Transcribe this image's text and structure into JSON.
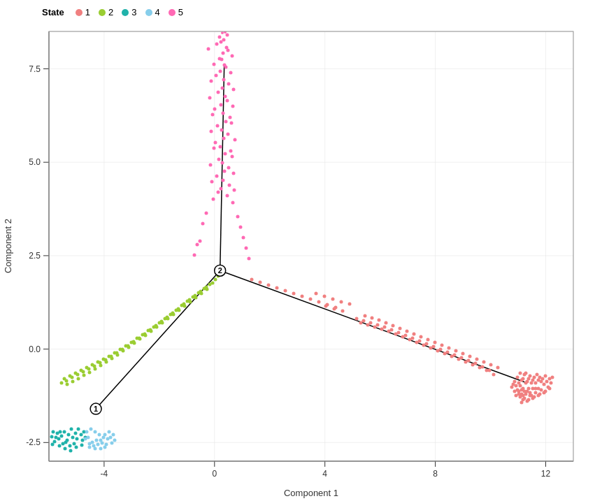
{
  "legend": {
    "title": "State",
    "items": [
      {
        "label": "1",
        "color": "#F08080"
      },
      {
        "label": "2",
        "color": "#9ACD32"
      },
      {
        "label": "3",
        "color": "#20B2AA"
      },
      {
        "label": "4",
        "color": "#87CEEB"
      },
      {
        "label": "5",
        "color": "#FF69B4"
      }
    ]
  },
  "xaxis": {
    "label": "Component 1",
    "ticks": [
      "-4",
      "0",
      "4",
      "8",
      "12"
    ]
  },
  "yaxis": {
    "label": "Component 2",
    "ticks": [
      "-2.5",
      "0.0",
      "2.5",
      "5.0",
      "7.5"
    ]
  },
  "colors": {
    "state1": "#F08080",
    "state2": "#9ACD32",
    "state3": "#20B2AA",
    "state4": "#87CEEB",
    "state5": "#FF69B4"
  }
}
